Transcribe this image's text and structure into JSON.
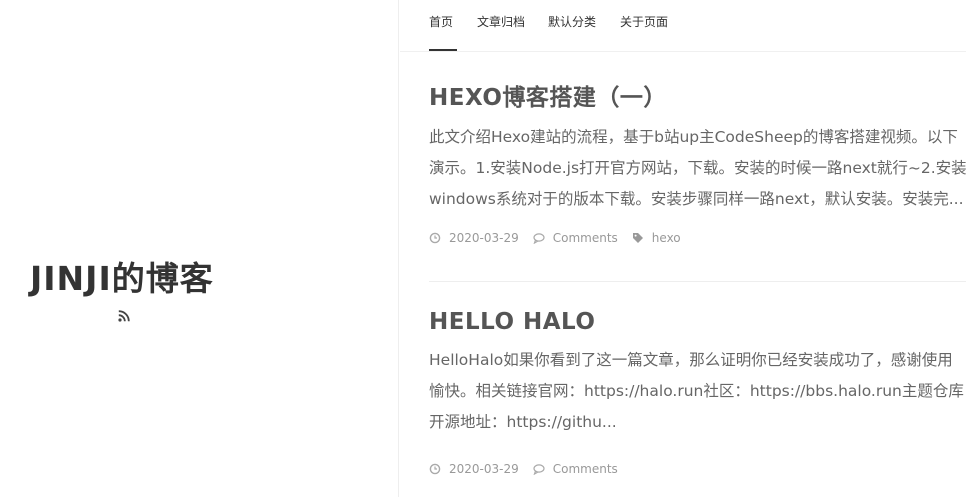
{
  "site": {
    "title": "JINJI的博客",
    "rss_icon": "rss-icon"
  },
  "nav": {
    "items": [
      "首页",
      "文章归档",
      "默认分类",
      "关于页面"
    ],
    "active_index": 0
  },
  "posts": [
    {
      "title": "HEXO博客搭建（一）",
      "excerpt_lines": [
        "此文介绍Hexo建站的流程，基于b站up主CodeSheep的博客搭建视频。以下",
        "演示。1.安装Node.js打开官方网站，下载。安装的时候一路next就行~2.安装",
        "windows系统对于的版本下载。安装步骤同样一路next，默认安装。安装完..."
      ],
      "date": "2020-03-29",
      "comments_label": "Comments",
      "tag": "hexo"
    },
    {
      "title": "HELLO HALO",
      "excerpt_lines": [
        "HelloHalo如果你看到了这一篇文章，那么证明你已经安装成功了，感谢使用",
        "愉快。相关链接官网：https://halo.run社区：https://bbs.halo.run主题仓库",
        "开源地址：https://githu..."
      ],
      "date": "2020-03-29",
      "comments_label": "Comments"
    }
  ],
  "icons": {
    "date": "clock-icon",
    "comments": "comment-icon",
    "tag": "tag-icon"
  },
  "colors": {
    "title": "#333333",
    "text": "#666666",
    "meta": "#999999",
    "divider": "#eeeeee"
  }
}
